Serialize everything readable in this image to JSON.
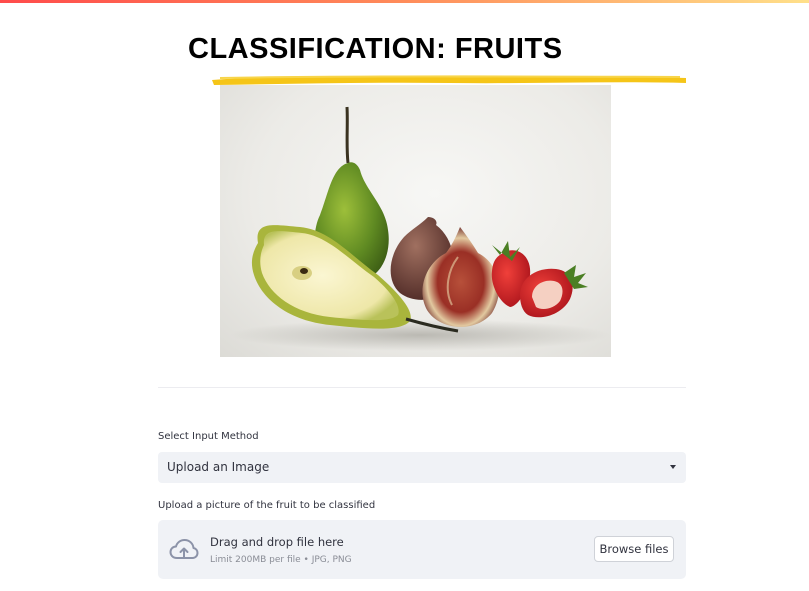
{
  "app": {
    "title": "CLASSIFICATION: FRUITS",
    "accent_color": "#ff4b4b",
    "title_underline_color": "#f5c518"
  },
  "hero": {
    "icon": "fruit-photo",
    "description_items": [
      "pear",
      "halved-pear",
      "fig",
      "halved-fig",
      "strawberry",
      "halved-strawberry"
    ]
  },
  "input_method": {
    "label": "Select Input Method",
    "selected": "Upload an Image"
  },
  "uploader": {
    "label": "Upload a picture of the fruit to be classified",
    "drop_text": "Drag and drop file here",
    "limit_text": "Limit 200MB per file • JPG, PNG",
    "browse_label": "Browse files",
    "icon": "cloud-upload-icon"
  }
}
